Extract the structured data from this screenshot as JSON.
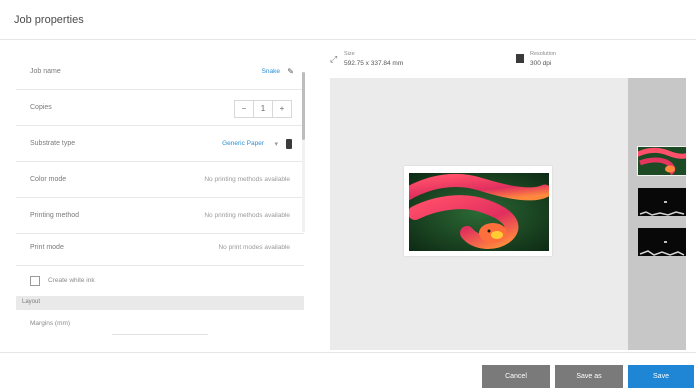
{
  "window": {
    "title": "Job properties"
  },
  "properties": {
    "job_name": {
      "label": "Job name",
      "value": "Snake"
    },
    "copies": {
      "label": "Copies",
      "value": "1",
      "minus": "−",
      "plus": "+"
    },
    "substrate": {
      "label": "Substrate type",
      "value": "Generic Paper",
      "caret": "▾"
    },
    "color_mode": {
      "label": "Color mode",
      "value": "No printing methods available"
    },
    "printing_method": {
      "label": "Printing method",
      "value": "No printing methods available"
    },
    "print_mode": {
      "label": "Print mode",
      "value": "No print modes available"
    },
    "checkbox": {
      "label": "Create white ink"
    },
    "layout_section": {
      "label": "Layout"
    },
    "margins": {
      "label": "Margins (mm)"
    }
  },
  "preview": {
    "size": {
      "label": "Size",
      "value": "592.75 x 337.84 mm"
    },
    "resolution": {
      "label": "Resolution",
      "value": "300 dpi"
    }
  },
  "icons": {
    "edit": "✎",
    "size": "⤢"
  },
  "footer": {
    "cancel": "Cancel",
    "save_as": "Save as",
    "save": "Save"
  },
  "colors": {
    "accent": "#1f86d6",
    "button_grey": "#7a7a7a",
    "link": "#2a8fd6"
  }
}
